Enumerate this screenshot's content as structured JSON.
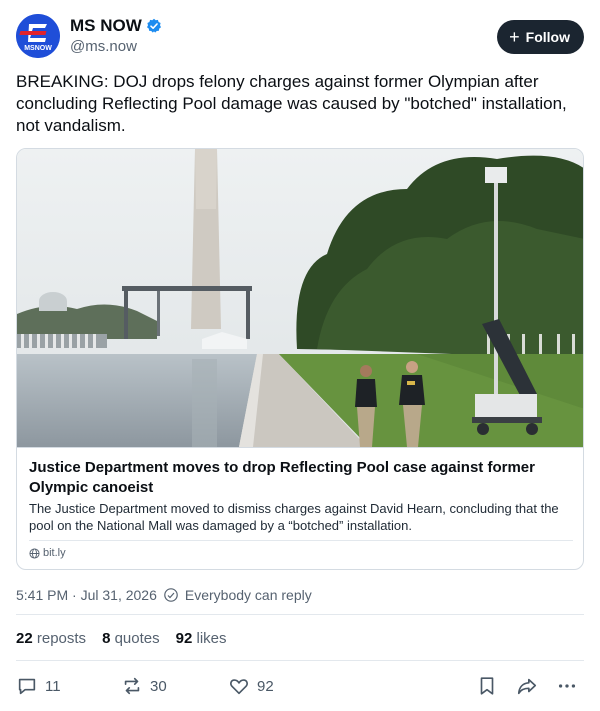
{
  "account": {
    "display_name": "MS NOW",
    "handle": "@ms.now",
    "avatar_text": "MSNOW",
    "verified_icon": "verified-badge-icon"
  },
  "follow_button": {
    "label": "Follow",
    "icon": "plus-icon"
  },
  "post": {
    "text": "BREAKING: DOJ drops felony charges against former Olympian after concluding Reflecting Pool damage was caused by \"botched\" installation, not vandalism."
  },
  "link_card": {
    "title": "Justice Department moves to drop Reflecting Pool case against former Olympic canoeist",
    "description": "The Justice Department moved to dismiss charges against David Hearn, concluding that the pool on the National Mall was damaged by a “botched” installation.",
    "domain": "bit.ly"
  },
  "meta": {
    "timestamp": "5:41 PM · Jul 31, 2026",
    "reply_setting": "Everybody can reply"
  },
  "stats": {
    "reposts_count": "22",
    "reposts_label": "reposts",
    "quotes_count": "8",
    "quotes_label": "quotes",
    "likes_count": "92",
    "likes_label": "likes"
  },
  "actions": {
    "replies": "11",
    "reposts": "30",
    "likes": "92"
  },
  "colors": {
    "avatar_bg": "#1f4ed8",
    "follow_bg": "#1b2530",
    "verified": "#1d8cf0",
    "secondary_text": "#566270"
  }
}
